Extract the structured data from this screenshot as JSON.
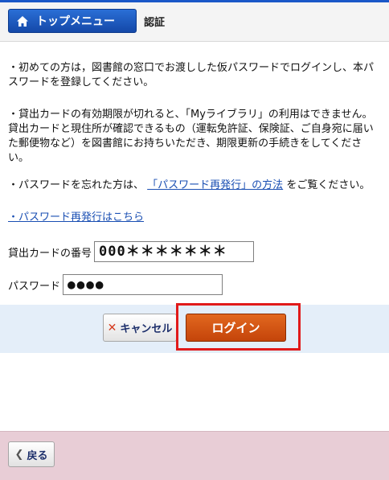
{
  "header": {
    "home_label": "トップメニュー",
    "page_title": "認証"
  },
  "notices": {
    "first_time": "・初めての方は，図書館の窓口でお渡しした仮パスワードでログインし、本パスワードを登録してください。",
    "expiry": "・貸出カードの有効期限が切れると、「Myライブラリ」の利用はできません。貸出カードと現住所が確認できるもの（運転免許証、保険証、ご自身宛に届いた郵便物など）を図書館にお持ちいただき、期限更新の手続きをしてください。",
    "forgot_prefix": "・パスワードを忘れた方は、",
    "forgot_link": "「パスワード再発行」の方法",
    "forgot_suffix": "をご覧ください。",
    "reissue_link": "・パスワード再発行はこちら"
  },
  "form": {
    "card_label": "貸出カードの番号",
    "card_value": "000＊＊＊＊＊＊＊",
    "password_label": "パスワード",
    "password_value": "●●●●"
  },
  "actions": {
    "cancel_label": "キャンセル",
    "login_label": "ログイン"
  },
  "footer": {
    "back_label": "戻る"
  },
  "colors": {
    "accent_blue": "#1a57c8",
    "login_orange": "#d4550f",
    "highlight_red": "#e11a1a",
    "footer_pink": "#e8cdd6",
    "action_band": "#e4eef9"
  }
}
